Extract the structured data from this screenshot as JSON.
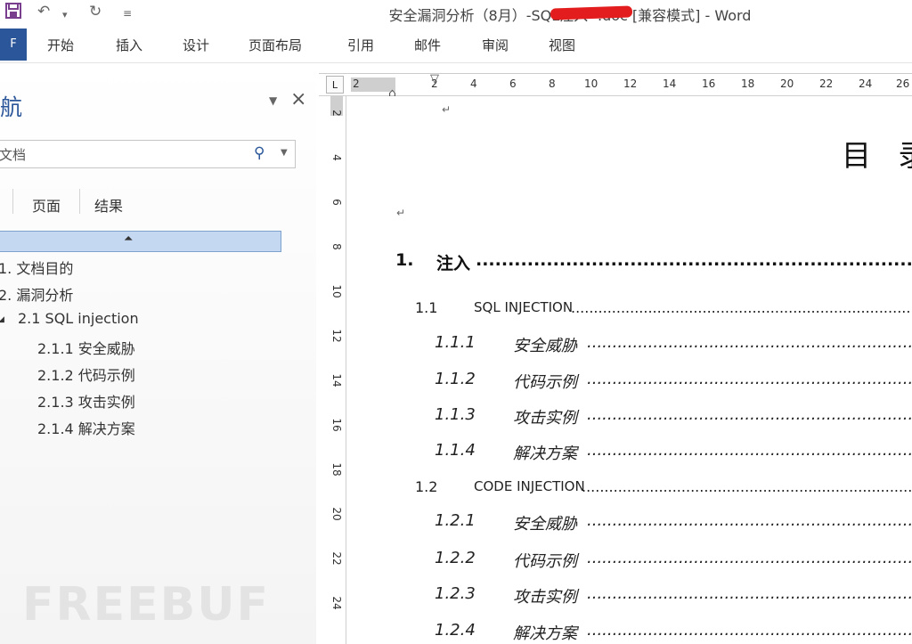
{
  "window": {
    "title": "安全漏洞分析（8月）-SQL注入-                .doc [兼容模式] - Word"
  },
  "quick_access": {
    "save_icon": "save-icon",
    "undo_icon": "undo-icon",
    "redo_icon": "redo-icon",
    "customize_icon": "customize-qat-icon"
  },
  "ribbon": {
    "file_label": "F",
    "tabs": [
      "开始",
      "插入",
      "设计",
      "页面布局",
      "引用",
      "邮件",
      "审阅",
      "视图"
    ]
  },
  "nav_pane": {
    "title": "航",
    "search_value": "文档",
    "tabs": [
      "页面",
      "结果"
    ],
    "tree": [
      "1. 文档目的",
      "2. 漏洞分析",
      "2.1 SQL injection",
      "2.1.1 安全威胁",
      "2.1.2 代码示例",
      "2.1.3 攻击实例",
      "2.1.4 解决方案"
    ],
    "watermark": "FREEBUF"
  },
  "ruler": {
    "tab_selector": "L",
    "horizontal": [
      "2",
      "2",
      "4",
      "6",
      "8",
      "10",
      "12",
      "14",
      "16",
      "18",
      "20",
      "22",
      "24",
      "26"
    ],
    "vertical": [
      "2",
      "4",
      "6",
      "8",
      "10",
      "12",
      "14",
      "16",
      "18",
      "20",
      "22",
      "24"
    ]
  },
  "document": {
    "paragraph_mark": "↵",
    "toc_title": "目 录",
    "dots": "........................................................................................................................................................................",
    "toc": [
      {
        "num": "1.",
        "text": "注入",
        "level": 1
      },
      {
        "num": "1.1",
        "text": "SQL INJECTION",
        "level": 2
      },
      {
        "num": "1.1.1",
        "text": "安全威胁",
        "level": 3
      },
      {
        "num": "1.1.2",
        "text": "代码示例",
        "level": 3
      },
      {
        "num": "1.1.3",
        "text": "攻击实例",
        "level": 3
      },
      {
        "num": "1.1.4",
        "text": "解决方案",
        "level": 3
      },
      {
        "num": "1.2",
        "text": "CODE INJECTION",
        "level": 2
      },
      {
        "num": "1.2.1",
        "text": "安全威胁",
        "level": 3
      },
      {
        "num": "1.2.2",
        "text": "代码示例",
        "level": 3
      },
      {
        "num": "1.2.3",
        "text": "攻击实例",
        "level": 3
      },
      {
        "num": "1.2.4",
        "text": "解决方案",
        "level": 3
      }
    ]
  },
  "colors": {
    "brand": "#2b579a",
    "selection": "#c5d8f1",
    "redaction": "#e31d1d"
  }
}
